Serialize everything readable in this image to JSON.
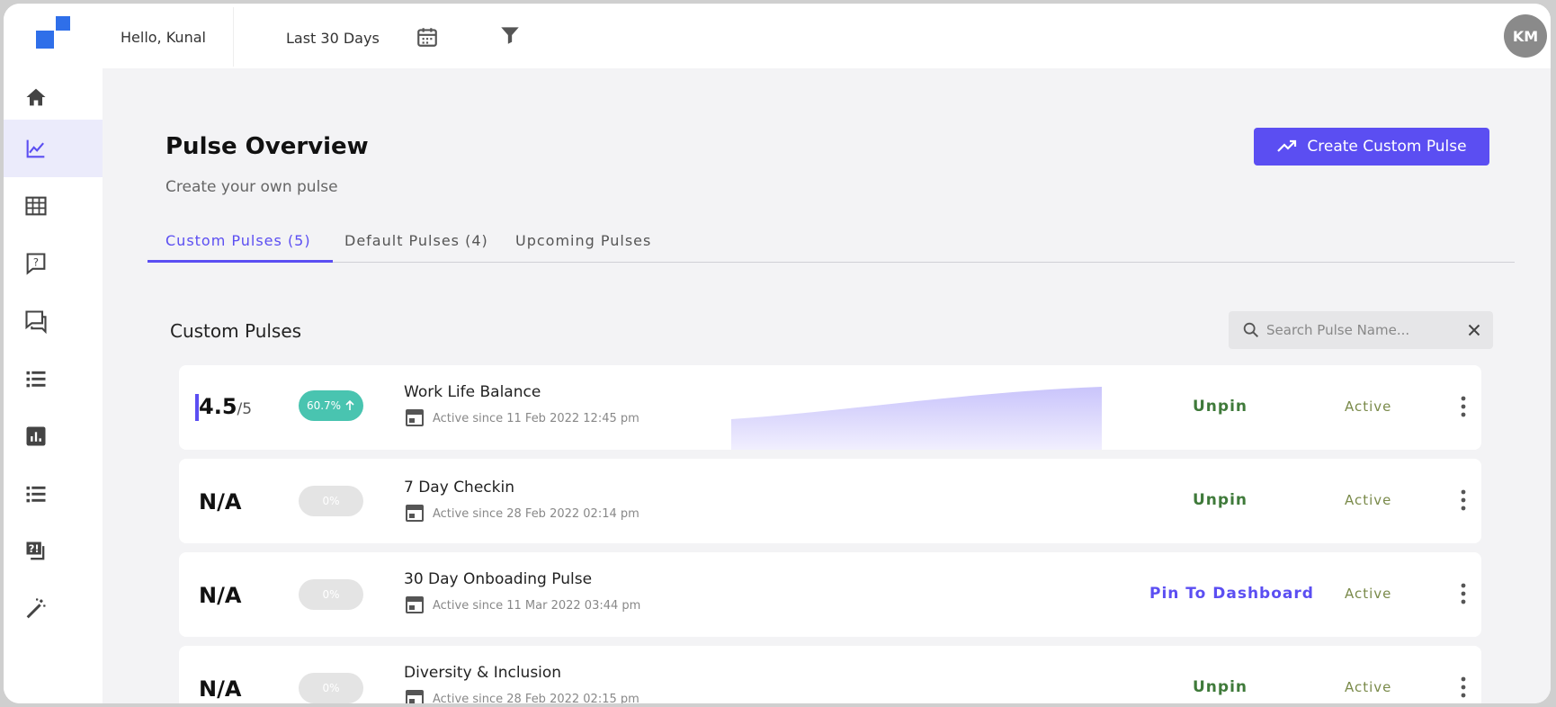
{
  "header": {
    "greeting": "Hello, Kunal",
    "date_range": "Last 30 Days",
    "avatar_initials": "KM"
  },
  "sidebar": {
    "items": [
      {
        "icon": "home-icon"
      },
      {
        "icon": "trend-chart-icon",
        "active": true
      },
      {
        "icon": "grid-table-icon"
      },
      {
        "icon": "question-bubble-icon"
      },
      {
        "icon": "chat-icon"
      },
      {
        "icon": "list-icon"
      },
      {
        "icon": "bar-chart-icon"
      },
      {
        "icon": "list-icon"
      },
      {
        "icon": "faq-icon"
      },
      {
        "icon": "magic-wand-icon"
      }
    ]
  },
  "main": {
    "title": "Pulse Overview",
    "subtitle": "Create your own pulse",
    "create_button": "Create Custom Pulse",
    "tabs": [
      {
        "label": "Custom Pulses (5)",
        "active": true
      },
      {
        "label": "Default Pulses (4)"
      },
      {
        "label": "Upcoming Pulses"
      }
    ],
    "section_title": "Custom Pulses",
    "search": {
      "placeholder": "Search Pulse Name...",
      "value": ""
    },
    "pulses": [
      {
        "score": "4.5",
        "score_max": "/5",
        "badge": "60.7%",
        "badge_trend": "up",
        "name": "Work Life Balance",
        "since": "Active since 11 Feb 2022 12:45 pm",
        "action": "Unpin",
        "status": "Active"
      },
      {
        "score": "N/A",
        "score_max": "",
        "badge": "0%",
        "badge_trend": "none",
        "name": "7 Day Checkin",
        "since": "Active since 28 Feb 2022 02:14 pm",
        "action": "Unpin",
        "status": "Active"
      },
      {
        "score": "N/A",
        "score_max": "",
        "badge": "0%",
        "badge_trend": "none",
        "name": "30 Day Onboading Pulse",
        "since": "Active since 11 Mar 2022 03:44 pm",
        "action": "Pin To Dashboard",
        "status": "Active"
      },
      {
        "score": "N/A",
        "score_max": "",
        "badge": "0%",
        "badge_trend": "none",
        "name": "Diversity & Inclusion",
        "since": "Active since 28 Feb 2022 02:15 pm",
        "action": "Unpin",
        "status": "Active"
      }
    ]
  },
  "colors": {
    "accent": "#5b4ef2",
    "badge_up": "#49c4b0",
    "unpin": "#3f7a3a",
    "active_status": "#7a8a4a"
  }
}
